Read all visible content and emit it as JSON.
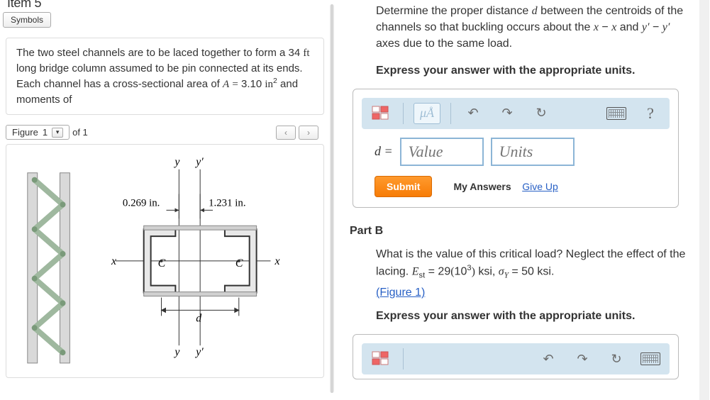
{
  "item_title": "Item 5",
  "symbols_label": "Symbols",
  "problem_text_html": "The two steel channels are to be laced together to form a 34 <span class='mn'>ft</span> long bridge column assumed to be pin connected at its ends. Each channel has a cross-sectional area of <span class='mi'>A</span> <span class='mn'>=</span> 3.10 <span class='mn'>in</span><span class='sup'>2</span> and moments of",
  "figure": {
    "label": "Figure",
    "index": "1",
    "of_label": "of 1",
    "dim_left": "0.269 in.",
    "dim_right": "1.231 in.",
    "axis_y": "y",
    "axis_yp": "y′",
    "axis_x": "x",
    "label_C": "C",
    "label_d": "d"
  },
  "partA": {
    "prompt_html": "Determine the proper distance <span class='mi'>d</span> between the centroids of the channels so that buckling occurs about the <span class='mi'>x</span> − <span class='mi'>x</span> and <span class='mi'>y′</span> − <span class='mi'>y′</span> axes due to the same load.",
    "express": "Express your answer with the appropriate units.",
    "mua_label": "μÅ",
    "var": "d =",
    "value_ph": "Value",
    "units_ph": "Units",
    "submit": "Submit",
    "my_answers": "My Answers",
    "give_up": "Give Up"
  },
  "partB": {
    "header": "Part B",
    "prompt_html": "What is the value of this critical load? Neglect the effect of the lacing. <span class='mi'>E</span><span class='sub'>st</span> = 29<span class='mn'>(</span>10<span class='sup'>3</span><span class='mn'>)</span> ksi, <span class='mi'>σ</span><span class='sub'><span class='mi'>Y</span></span> = 50 ksi.",
    "fig_link": "(Figure 1)",
    "express": "Express your answer with the appropriate units."
  }
}
